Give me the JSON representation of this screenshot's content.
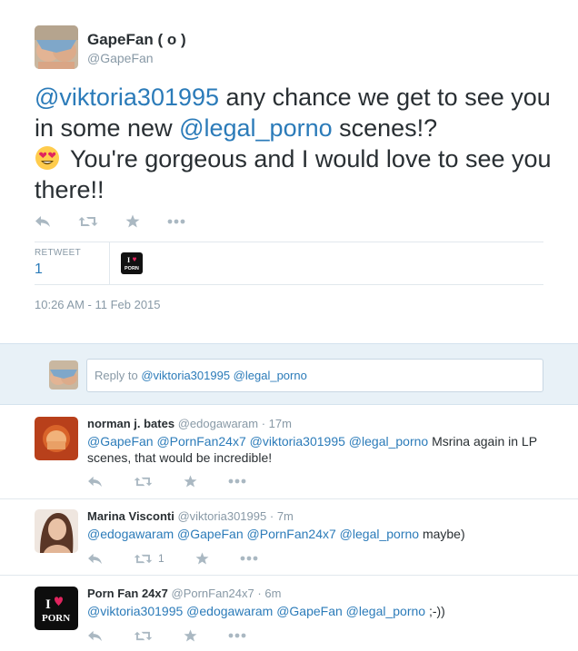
{
  "main_tweet": {
    "display_name": "GapeFan ( o )",
    "handle": "@GapeFan",
    "text": {
      "mention1": "@viktoria301995",
      "part1": " any chance we get to see you in some new ",
      "mention2": "@legal_porno",
      "part2": " scenes!? ",
      "emoji": "heart-eyes-emoji",
      "part3": " You're gorgeous and I would love to see you there!!"
    },
    "stats": {
      "retweet_label": "RETWEET",
      "retweet_count": "1"
    },
    "timestamp": "10:26 AM - 11 Feb 2015"
  },
  "reply_box": {
    "prefix": "Reply to ",
    "mentions": "@viktoria301995 @legal_porno"
  },
  "replies": [
    {
      "name": "norman j. bates",
      "handle": "@edogawaram",
      "time": "17m",
      "mentions": "@GapeFan @PornFan24x7 @viktoria301995 @legal_porno",
      "text": " Msrina again in LP scenes, that would be incredible!",
      "retweet_count": ""
    },
    {
      "name": "Marina Visconti",
      "handle": "@viktoria301995",
      "time": "7m",
      "mentions": "@edogawaram @GapeFan @PornFan24x7 @legal_porno",
      "text": " maybe)",
      "retweet_count": "1"
    },
    {
      "name": "Porn Fan 24x7",
      "handle": "@PornFan24x7",
      "time": "6m",
      "mentions": "@viktoria301995 @edogawaram @GapeFan @legal_porno",
      "text": " ;-))",
      "retweet_count": ""
    }
  ],
  "logo": {
    "line1": "I",
    "line2": "PORN"
  },
  "icons": [
    "reply-icon",
    "retweet-icon",
    "favorite-icon",
    "more-icon"
  ],
  "colors": {
    "link": "#2b7bb9",
    "muted": "#8899a6",
    "icon": "#aab8c2",
    "reply_bg": "#e8f1f7"
  }
}
